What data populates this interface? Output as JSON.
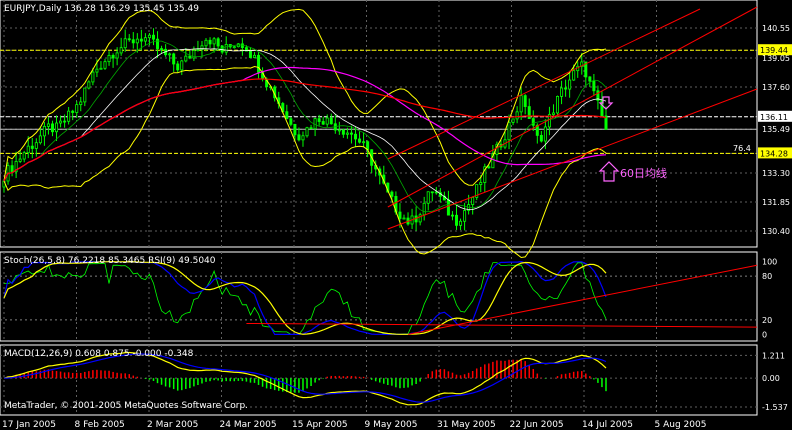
{
  "chart_data": [
    {
      "type": "candlestick",
      "title": "EURJPY,Daily  136.28 136.29 135.45 135.49",
      "ylim": [
        129.8,
        141.2
      ],
      "y_ticks": [
        140.55,
        139.44,
        139.05,
        137.6,
        136.11,
        135.49,
        134.28,
        133.3,
        131.85,
        130.4
      ],
      "price_markers": [
        {
          "value": 139.44,
          "label": "139.44",
          "color": "#ffff00"
        },
        {
          "value": 136.11,
          "label": "136.11",
          "color": "#ffffff"
        },
        {
          "value": 134.28,
          "label": "134.28",
          "color": "#ffff00"
        }
      ],
      "annotations": [
        "76.4",
        "60日均线"
      ],
      "close_trend": [
        133.2,
        133.6,
        134.0,
        134.5,
        134.8,
        135.2,
        135.6,
        135.5,
        135.9,
        136.3,
        136.8,
        137.6,
        138.4,
        138.8,
        139.2,
        139.5,
        139.7,
        139.9,
        140.1,
        140.0,
        139.7,
        139.3,
        139.0,
        138.6,
        138.9,
        139.3,
        139.8,
        140.1,
        139.8,
        139.4,
        139.6,
        139.9,
        139.7,
        139.2,
        138.5,
        137.8,
        137.2,
        136.5,
        135.8,
        135.2,
        135.4,
        135.8,
        136.1,
        135.9,
        135.7,
        135.5,
        135.3,
        135.0,
        134.5,
        133.8,
        133.0,
        132.2,
        131.6,
        131.1,
        130.8,
        131.2,
        131.9,
        132.5,
        132.0,
        131.4,
        130.9,
        131.3,
        131.9,
        132.6,
        133.4,
        134.1,
        134.8,
        135.6,
        136.4,
        137.1,
        135.8,
        134.9,
        135.6,
        136.5,
        137.3,
        137.9,
        138.4,
        138.7,
        137.6,
        136.6,
        135.5
      ]
    },
    {
      "type": "line",
      "title": "Stoch(26,5,8) 76.2218 85.3465  RSI(9) 49.5040",
      "ylim": [
        -5,
        105
      ],
      "y_ticks": [
        100,
        80,
        20,
        0
      ],
      "levels": [
        80,
        20
      ]
    },
    {
      "type": "bar",
      "title": "MACD(12,26,9) 0.608 0.875 -0.000 -0.348",
      "ylim": [
        -1.8,
        1.5
      ],
      "y_ticks": [
        1.211,
        0.0,
        -1.537
      ]
    }
  ],
  "x_axis": {
    "tick_labels": [
      "17 Jan 2005",
      "8 Feb 2005",
      "2 Mar 2005",
      "24 Mar 2005",
      "15 Apr 2005",
      "9 May 2005",
      "31 May 2005",
      "22 Jun 2005",
      "14 Jul 2005",
      "5 Aug 2005"
    ]
  },
  "watermark": "MetaTrader, © 2001-2005 MetaQuotes Software Corp.",
  "colors": {
    "background": "#000000",
    "bull": "#00ff00",
    "bear": "#00ff00",
    "bollinger": "#ffff00",
    "ma_red": "#ff0000",
    "ma_magenta": "#ff00ff",
    "channel": "#ff0000",
    "stoch_main": "#0000ff",
    "stoch_signal": "#ffff00",
    "rsi": "#00ff00",
    "macd": "#ffff00",
    "macd_signal": "#0000ff",
    "hist_pos": "#ff0000",
    "hist_neg": "#00ff00"
  }
}
